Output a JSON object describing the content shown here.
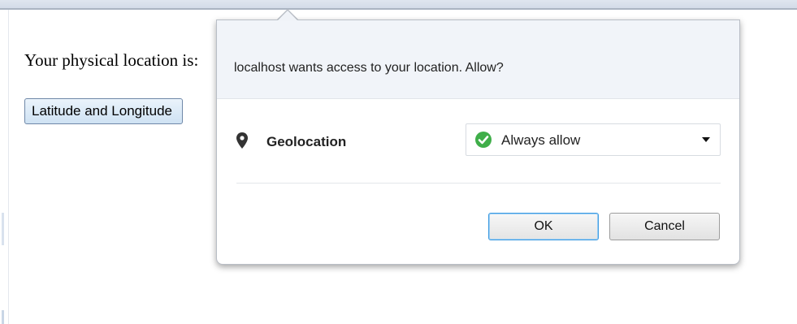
{
  "page": {
    "body_text": "Your physical location is:",
    "button_label": "Latitude and Longitude"
  },
  "popup": {
    "title": "localhost wants access to your location. Allow?",
    "permission": {
      "icon": "location-pin-icon",
      "label": "Geolocation",
      "selected_option": "Always allow",
      "selected_icon": "green-check-icon",
      "status_color": "#3fae49"
    },
    "ok_label": "OK",
    "cancel_label": "Cancel",
    "ok_accent_color": "#3c9ae0"
  }
}
